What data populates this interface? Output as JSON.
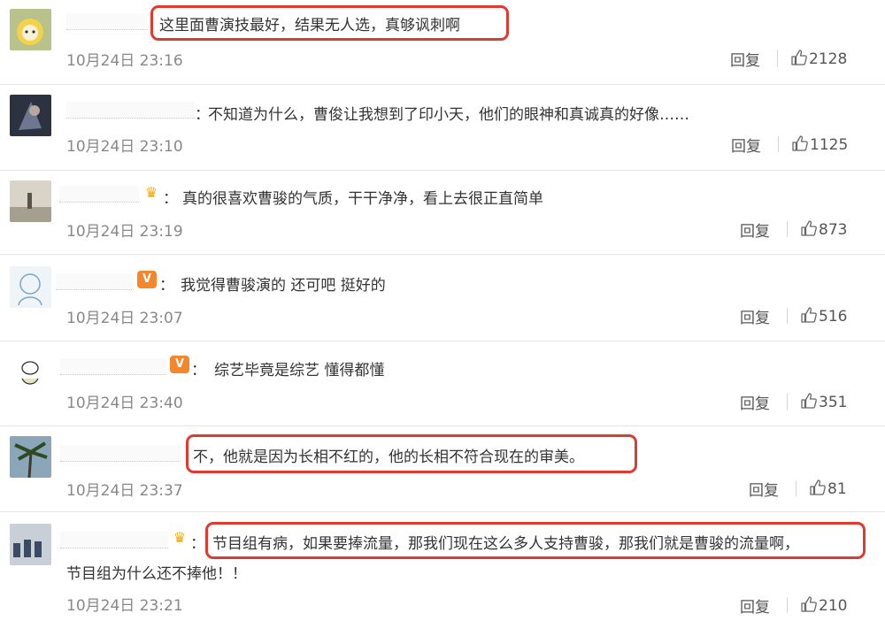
{
  "comments": [
    {
      "text": "这里面曹演技最好，结果无人选，真够讽刺啊",
      "time": "10月24日 23:16",
      "reply_label": "回复",
      "likes": "2128",
      "badge": "",
      "highlighted": true
    },
    {
      "text": "不知道为什么，曹俊让我想到了印小天，他们的眼神和真诚真的好像……",
      "time": "10月24日 23:10",
      "reply_label": "回复",
      "likes": "1125",
      "badge": "",
      "highlighted": false
    },
    {
      "text": "真的很喜欢曹骏的气质，干干净净，看上去很正直简单",
      "time": "10月24日 23:19",
      "reply_label": "回复",
      "likes": "873",
      "badge": "crown",
      "highlighted": false
    },
    {
      "text": "我觉得曹骏演的 还可吧 挺好的",
      "time": "10月24日 23:07",
      "reply_label": "回复",
      "likes": "516",
      "badge": "V",
      "highlighted": false
    },
    {
      "text": "综艺毕竟是综艺 懂得都懂",
      "time": "10月24日 23:40",
      "reply_label": "回复",
      "likes": "351",
      "badge": "V",
      "highlighted": false
    },
    {
      "text": "不，他就是因为长相不红的，他的长相不符合现在的审美。",
      "time": "10月24日 23:37",
      "reply_label": "回复",
      "likes": "81",
      "badge": "",
      "highlighted": true
    },
    {
      "text_line1": "节目组有病，如果要捧流量，那我们现在这么多人支持曹骏，那我们就是曹骏的流量啊，",
      "text_line2": "节目组为什么还不捧他！！",
      "time": "10月24日 23:21",
      "reply_label": "回复",
      "likes": "210",
      "badge": "crown",
      "highlighted": true
    }
  ],
  "colon": "：",
  "icons": {
    "like": "thumbs-up-icon",
    "crown": "crown-icon",
    "vip": "v-badge-icon"
  },
  "colors": {
    "highlight": "#e0392f",
    "vip_badge": "#f4862b",
    "crown": "#f1a400",
    "time": "#888888"
  }
}
